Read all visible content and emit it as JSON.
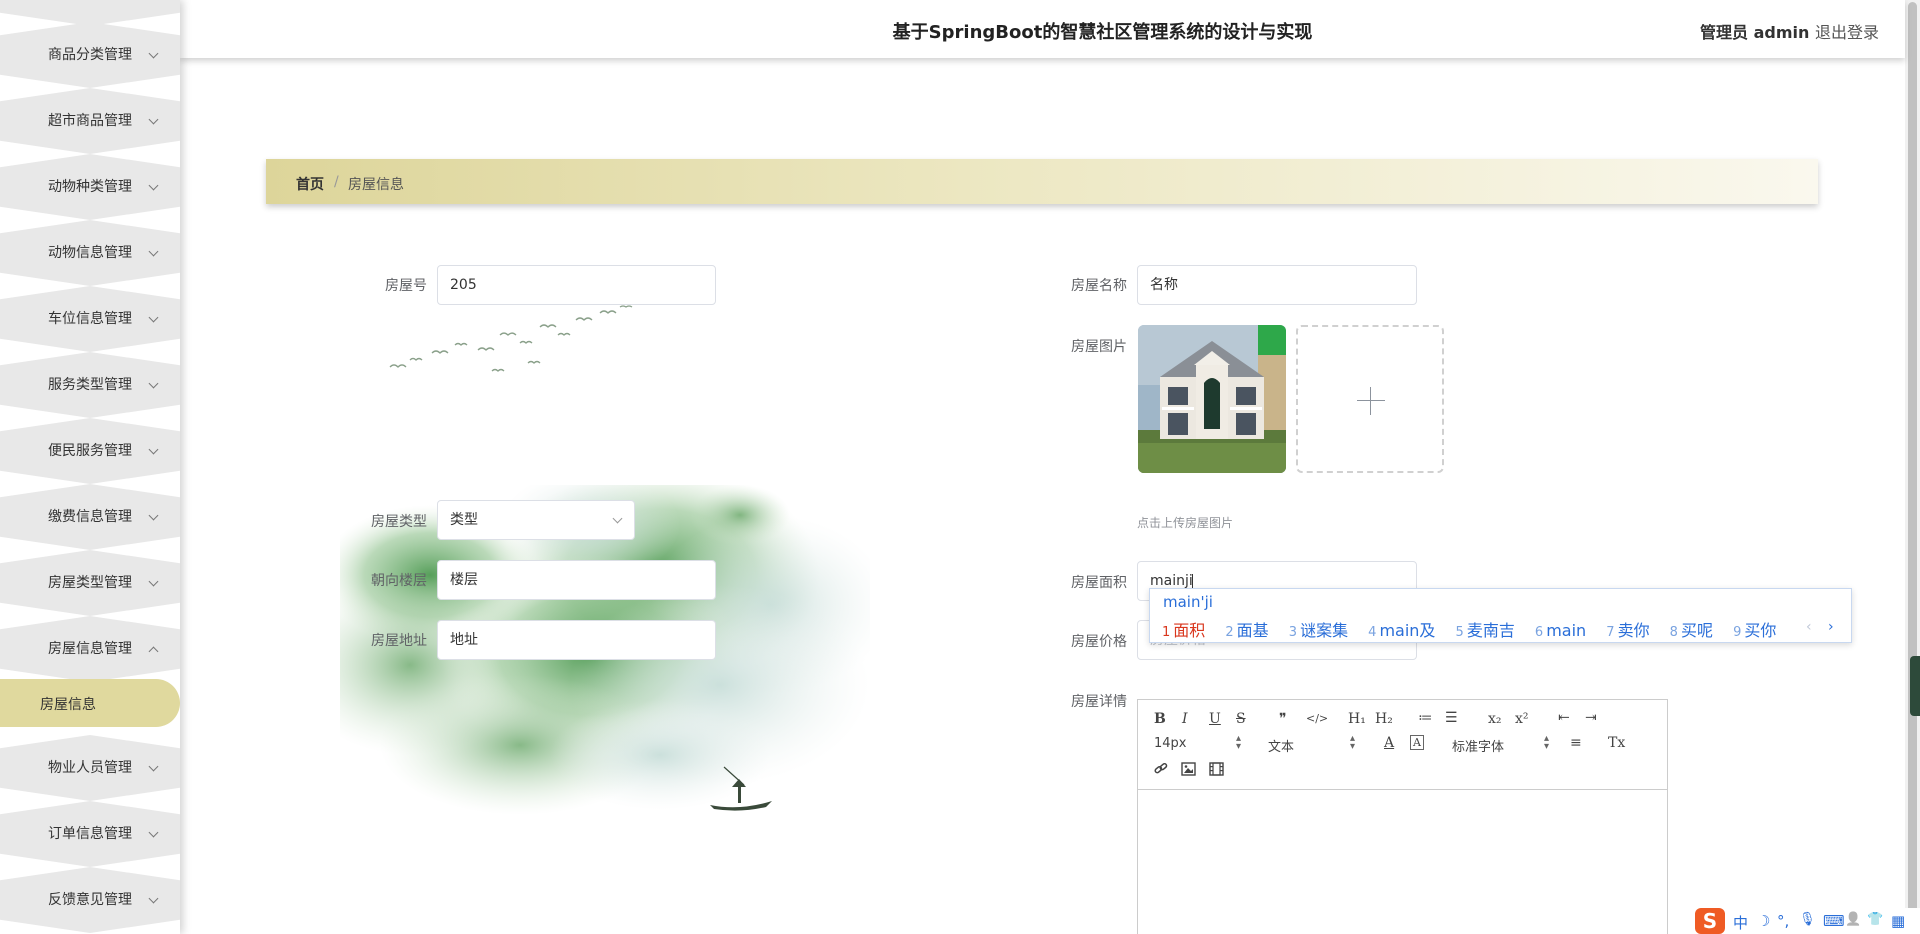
{
  "header": {
    "title": "基于SpringBoot的智慧社区管理系统的设计与实现",
    "user": "管理员 admin",
    "logout": "退出登录"
  },
  "sidebar": {
    "items": [
      {
        "label": "商品分类管理",
        "icon": "chevron-down-icon"
      },
      {
        "label": "超市商品管理",
        "icon": "chevron-down-icon"
      },
      {
        "label": "动物种类管理",
        "icon": "chevron-down-icon"
      },
      {
        "label": "动物信息管理",
        "icon": "chevron-down-icon"
      },
      {
        "label": "车位信息管理",
        "icon": "chevron-down-icon"
      },
      {
        "label": "服务类型管理",
        "icon": "chevron-down-icon"
      },
      {
        "label": "便民服务管理",
        "icon": "chevron-down-icon"
      },
      {
        "label": "缴费信息管理",
        "icon": "chevron-down-icon"
      },
      {
        "label": "房屋类型管理",
        "icon": "chevron-down-icon"
      },
      {
        "label": "房屋信息管理",
        "icon": "chevron-up-icon"
      },
      {
        "label": "物业人员管理",
        "icon": "chevron-down-icon"
      },
      {
        "label": "订单信息管理",
        "icon": "chevron-down-icon"
      },
      {
        "label": "反馈意见管理",
        "icon": "chevron-down-icon"
      }
    ],
    "active_sub": "房屋信息"
  },
  "breadcrumb": {
    "home": "首页",
    "separator": "/",
    "current": "房屋信息"
  },
  "form": {
    "house_no": {
      "label": "房屋号",
      "value": "205"
    },
    "house_name": {
      "label": "房屋名称",
      "value": "名称"
    },
    "house_image": {
      "label": "房屋图片",
      "hint": "点击上传房屋图片"
    },
    "house_type": {
      "label": "房屋类型",
      "value": "类型"
    },
    "floor": {
      "label": "朝向楼层",
      "value": "楼层"
    },
    "address": {
      "label": "房屋地址",
      "value": "地址"
    },
    "area": {
      "label": "房屋面积",
      "value": "mainji"
    },
    "price": {
      "label": "房屋价格",
      "placeholder": "房屋价格"
    },
    "details": {
      "label": "房屋详情"
    }
  },
  "editor": {
    "font_size": "14px",
    "format": "文本",
    "font_family": "标准字体",
    "buttons": {
      "bold": "B",
      "italic": "I",
      "underline": "U",
      "strike": "S",
      "quote": "❞",
      "code": "</>",
      "h1": "H₁",
      "h2": "H₂",
      "ordered": "≔",
      "bullet": "☰",
      "sub": "x₂",
      "sup": "x²",
      "outdent": "⇤",
      "indent": "⇥",
      "color": "A",
      "background": "A",
      "align": "≡",
      "clean": "Tx"
    }
  },
  "ime": {
    "composition": "main'ji",
    "candidates": [
      {
        "n": "1",
        "text": "面积"
      },
      {
        "n": "2",
        "text": "面基"
      },
      {
        "n": "3",
        "text": "谜案集"
      },
      {
        "n": "4",
        "text": "main及"
      },
      {
        "n": "5",
        "text": "麦南吉"
      },
      {
        "n": "6",
        "text": "main"
      },
      {
        "n": "7",
        "text": "卖你"
      },
      {
        "n": "8",
        "text": "买呢"
      },
      {
        "n": "9",
        "text": "买你"
      }
    ],
    "prev": "‹",
    "next": "›"
  },
  "tray": {
    "sogou": "S",
    "lang": "中",
    "moon": "☽",
    "punct": "°,",
    "mic": "🎙",
    "keyboard": "⌨",
    "user": "👤",
    "shirt": "👕",
    "grid": "▦"
  },
  "colors": {
    "accent": "#e0d99e",
    "ime_blue": "#2a6ed8",
    "ime_red": "#d9361d",
    "sogou": "#ef5b24"
  }
}
